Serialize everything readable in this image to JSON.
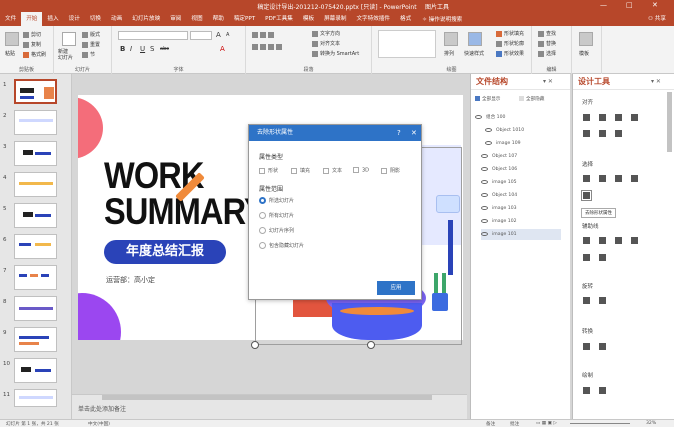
{
  "title_bar": {
    "title": "稿定设计导出-201212-075420.pptx [只读] - PowerPoint",
    "context_tab": "图片工具",
    "wc_min": "—",
    "wc_max": "□",
    "wc_close": "✕"
  },
  "tabs": [
    {
      "label": "文件"
    },
    {
      "label": "开始",
      "active": true
    },
    {
      "label": "插入"
    },
    {
      "label": "设计"
    },
    {
      "label": "切换"
    },
    {
      "label": "动画"
    },
    {
      "label": "幻灯片放映"
    },
    {
      "label": "审阅"
    },
    {
      "label": "视图"
    },
    {
      "label": "帮助"
    },
    {
      "label": "稿定PPT"
    },
    {
      "label": "PDF工具集"
    },
    {
      "label": "模板"
    },
    {
      "label": "屏幕录制"
    },
    {
      "label": "文字特效插件"
    },
    {
      "label": "格式"
    }
  ],
  "search_placeholder": "操作说明搜索",
  "share_label": "共享",
  "ribbon": {
    "clipboard": {
      "label": "剪贴板",
      "paste": "粘贴",
      "cut": "剪切",
      "copy": "复制",
      "painter": "格式刷"
    },
    "slides": {
      "label": "幻灯片",
      "new_slide": "新建\n幻灯片",
      "layout": "版式",
      "reset": "重置",
      "section": "节"
    },
    "font": {
      "label": "字体",
      "aa_big": "A",
      "aa_small": "A",
      "bold": "B",
      "italic": "I",
      "underline": "U",
      "shadow": "S",
      "strike": "abc",
      "color": "A"
    },
    "paragraph": {
      "label": "段落",
      "text_dir": "文字方向",
      "align_text": "对齐文本",
      "smartart": "转换为 SmartArt"
    },
    "drawing": {
      "label": "绘图",
      "arrange": "排列",
      "quick_styles": "快速样式",
      "fill": "形状填充",
      "outline": "形状轮廓",
      "effects": "形状效果"
    },
    "editing": {
      "label": "编辑",
      "find": "查找",
      "replace": "替换",
      "select": "选择"
    },
    "template": {
      "label": "模板"
    }
  },
  "thumbnails": [
    "1",
    "2",
    "3",
    "4",
    "5",
    "6",
    "7",
    "8",
    "9",
    "10",
    "11"
  ],
  "slide": {
    "line1": "WORK",
    "line2": "SUMMARY",
    "pill": "年度总结汇报",
    "reporter": "运营部：高小定"
  },
  "dialog": {
    "title": "去除形状属性",
    "help": "?",
    "close": "✕",
    "section_attr": "属性类型",
    "attrs": [
      "形状",
      "填充",
      "文本",
      "3D",
      "阴影"
    ],
    "section_range": "属性范围",
    "ranges": [
      {
        "label": "所选幻灯片",
        "checked": true
      },
      {
        "label": "所有幻灯片",
        "checked": false
      },
      {
        "label": "幻灯片序列",
        "checked": false
      },
      {
        "label": "包含隐藏幻灯片",
        "checked": false
      }
    ],
    "apply": "应用"
  },
  "notes": "单击此处添加备注",
  "file_structure": {
    "title": "文件结构",
    "controls": "▾ ✕",
    "show_all": "全部显示",
    "hide_all": "全部隐藏",
    "items": [
      {
        "label": "组合 100",
        "group": true
      },
      {
        "label": "Object 1010",
        "indent": true
      },
      {
        "label": "image 109",
        "indent": true
      },
      {
        "label": "Object 107"
      },
      {
        "label": "Object 106"
      },
      {
        "label": "image 105"
      },
      {
        "label": "Object 104"
      },
      {
        "label": "image 103"
      },
      {
        "label": "image 102"
      },
      {
        "label": "image 101"
      }
    ]
  },
  "design_tools": {
    "title": "设计工具",
    "controls": "▾ ✕",
    "align": "对齐",
    "select": "选择",
    "tooltip": "去除形状属性",
    "guides": "辅助线",
    "rotate": "旋转",
    "convert": "转换",
    "draw": "绘制"
  },
  "status": {
    "slide_info": "幻灯片 第 1 张，共 21 张",
    "lang": "中文(中国)",
    "notes_btn": "备注",
    "comments_btn": "批注",
    "zoom": "32%"
  },
  "colors": {
    "brand": "#b7472a",
    "dialog_blue": "#2e73c7",
    "pill_blue": "#2a43b8"
  }
}
